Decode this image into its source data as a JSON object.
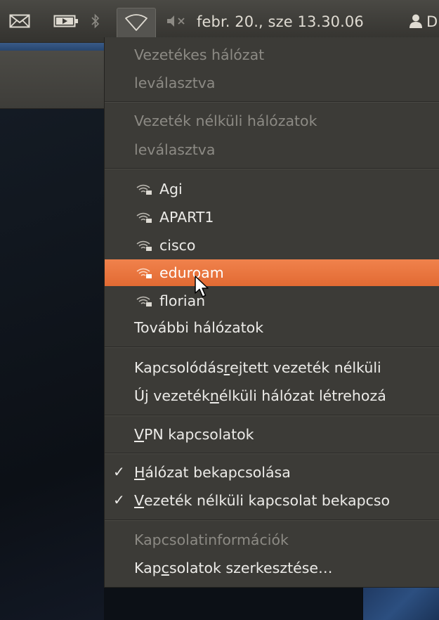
{
  "topbar": {
    "clock": "febr. 20., sze 13.30.06",
    "user_partial": "D",
    "icons": [
      "mail-icon",
      "battery-icon",
      "bluetooth-icon",
      "wireless-network-icon",
      "volume-muted-icon",
      "user-icon"
    ]
  },
  "menu": {
    "wired_header": "Vezetékes hálózat",
    "wired_status": "leválasztva",
    "wireless_header": "Vezeték nélküli hálózatok",
    "wireless_status": "leválasztva",
    "networks": [
      {
        "name": "Agi"
      },
      {
        "name": "APART1"
      },
      {
        "name": "cisco"
      },
      {
        "name": "eduroam"
      },
      {
        "name": "florian"
      }
    ],
    "more_networks": "További hálózatok",
    "hidden_prefix": "Kapcsolódás ",
    "hidden_mnemonic": "r",
    "hidden_suffix": "ejtett vezeték nélküli",
    "new_prefix": "Új vezeték ",
    "new_mnemonic": "n",
    "new_suffix": "élküli hálózat létrehozá",
    "vpn_mnemonic": "V",
    "vpn_suffix": "PN kapcsolatok",
    "enable_net_mnemonic": "H",
    "enable_net_suffix": "álózat bekapcsolása",
    "enable_wifi_mnemonic": "V",
    "enable_wifi_suffix": "ezeték nélküli kapcsolat bekapcso",
    "conn_info": "Kapcsolatinformációk",
    "edit_prefix": "Kap",
    "edit_mnemonic": "c",
    "edit_suffix": "solatok szerkesztése…",
    "check_symbol": "✓"
  },
  "colors": {
    "panel": "#3c3b37",
    "highlight": "#e8763d",
    "text": "#ecebe8",
    "disabled_text": "#8c8a84"
  }
}
